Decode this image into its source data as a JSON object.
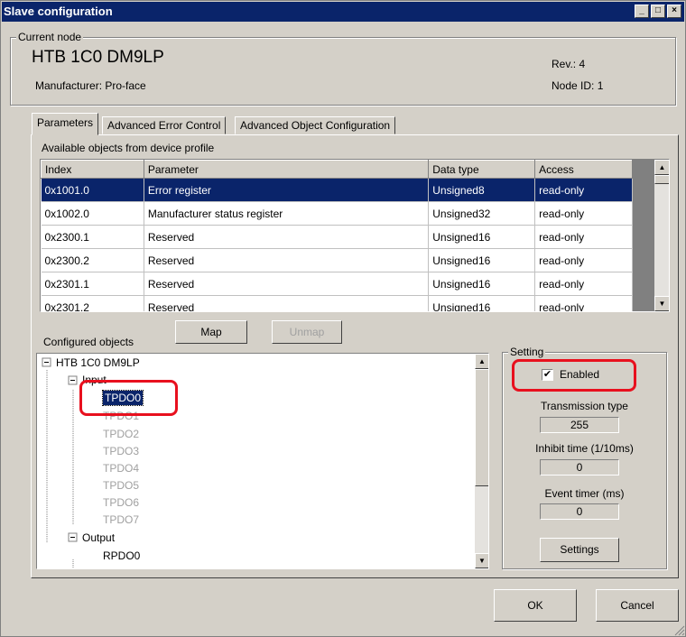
{
  "window": {
    "title": "Slave configuration"
  },
  "node": {
    "group_label": "Current node",
    "name": "HTB 1C0 DM9LP",
    "manufacturer": "Manufacturer: Pro-face",
    "rev": "Rev.: 4",
    "node_id": "Node ID: 1"
  },
  "tabs": [
    "Parameters",
    "Advanced Error Control",
    "Advanced Object Configuration"
  ],
  "objects": {
    "label": "Available objects from device profile",
    "columns": [
      "Index",
      "Parameter",
      "Data type",
      "Access"
    ],
    "rows": [
      [
        "0x1001.0",
        "Error register",
        "Unsigned8",
        "read-only"
      ],
      [
        "0x1002.0",
        "Manufacturer status register",
        "Unsigned32",
        "read-only"
      ],
      [
        "0x2300.1",
        "Reserved",
        "Unsigned16",
        "read-only"
      ],
      [
        "0x2300.2",
        "Reserved",
        "Unsigned16",
        "read-only"
      ],
      [
        "0x2301.1",
        "Reserved",
        "Unsigned16",
        "read-only"
      ],
      [
        "0x2301.2",
        "Reserved",
        "Unsigned16",
        "read-only"
      ]
    ]
  },
  "configured": {
    "label": "Configured objects",
    "map": "Map",
    "unmap": "Unmap",
    "tree": {
      "root": "HTB 1C0 DM9LP",
      "input": "Input",
      "tpdo": [
        "TPDO0",
        "TPDO1",
        "TPDO2",
        "TPDO3",
        "TPDO4",
        "TPDO5",
        "TPDO6",
        "TPDO7"
      ],
      "output": "Output",
      "rpdo": [
        "RPDO0"
      ]
    }
  },
  "setting": {
    "group_label": "Setting",
    "enabled_label": "Enabled",
    "enabled": true,
    "transmission_label": "Transmission type",
    "transmission_value": "255",
    "inhibit_label": "Inhibit time (1/10ms)",
    "inhibit_value": "0",
    "event_label": "Event timer (ms)",
    "event_value": "0",
    "settings_button": "Settings"
  },
  "footer": {
    "ok": "OK",
    "cancel": "Cancel"
  },
  "colors": {
    "titlebar": "#0a246a",
    "highlight": "#e8101e"
  }
}
